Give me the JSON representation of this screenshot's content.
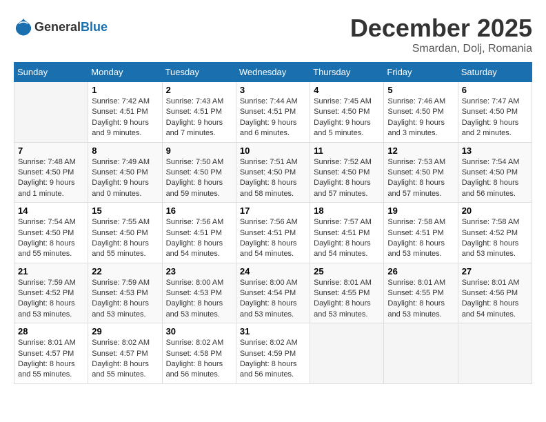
{
  "header": {
    "logo_general": "General",
    "logo_blue": "Blue",
    "month": "December 2025",
    "location": "Smardan, Dolj, Romania"
  },
  "weekdays": [
    "Sunday",
    "Monday",
    "Tuesday",
    "Wednesday",
    "Thursday",
    "Friday",
    "Saturday"
  ],
  "weeks": [
    [
      {
        "day": null
      },
      {
        "day": 1,
        "sunrise": "Sunrise: 7:42 AM",
        "sunset": "Sunset: 4:51 PM",
        "daylight": "Daylight: 9 hours and 9 minutes."
      },
      {
        "day": 2,
        "sunrise": "Sunrise: 7:43 AM",
        "sunset": "Sunset: 4:51 PM",
        "daylight": "Daylight: 9 hours and 7 minutes."
      },
      {
        "day": 3,
        "sunrise": "Sunrise: 7:44 AM",
        "sunset": "Sunset: 4:51 PM",
        "daylight": "Daylight: 9 hours and 6 minutes."
      },
      {
        "day": 4,
        "sunrise": "Sunrise: 7:45 AM",
        "sunset": "Sunset: 4:50 PM",
        "daylight": "Daylight: 9 hours and 5 minutes."
      },
      {
        "day": 5,
        "sunrise": "Sunrise: 7:46 AM",
        "sunset": "Sunset: 4:50 PM",
        "daylight": "Daylight: 9 hours and 3 minutes."
      },
      {
        "day": 6,
        "sunrise": "Sunrise: 7:47 AM",
        "sunset": "Sunset: 4:50 PM",
        "daylight": "Daylight: 9 hours and 2 minutes."
      }
    ],
    [
      {
        "day": 7,
        "sunrise": "Sunrise: 7:48 AM",
        "sunset": "Sunset: 4:50 PM",
        "daylight": "Daylight: 9 hours and 1 minute."
      },
      {
        "day": 8,
        "sunrise": "Sunrise: 7:49 AM",
        "sunset": "Sunset: 4:50 PM",
        "daylight": "Daylight: 9 hours and 0 minutes."
      },
      {
        "day": 9,
        "sunrise": "Sunrise: 7:50 AM",
        "sunset": "Sunset: 4:50 PM",
        "daylight": "Daylight: 8 hours and 59 minutes."
      },
      {
        "day": 10,
        "sunrise": "Sunrise: 7:51 AM",
        "sunset": "Sunset: 4:50 PM",
        "daylight": "Daylight: 8 hours and 58 minutes."
      },
      {
        "day": 11,
        "sunrise": "Sunrise: 7:52 AM",
        "sunset": "Sunset: 4:50 PM",
        "daylight": "Daylight: 8 hours and 57 minutes."
      },
      {
        "day": 12,
        "sunrise": "Sunrise: 7:53 AM",
        "sunset": "Sunset: 4:50 PM",
        "daylight": "Daylight: 8 hours and 57 minutes."
      },
      {
        "day": 13,
        "sunrise": "Sunrise: 7:54 AM",
        "sunset": "Sunset: 4:50 PM",
        "daylight": "Daylight: 8 hours and 56 minutes."
      }
    ],
    [
      {
        "day": 14,
        "sunrise": "Sunrise: 7:54 AM",
        "sunset": "Sunset: 4:50 PM",
        "daylight": "Daylight: 8 hours and 55 minutes."
      },
      {
        "day": 15,
        "sunrise": "Sunrise: 7:55 AM",
        "sunset": "Sunset: 4:50 PM",
        "daylight": "Daylight: 8 hours and 55 minutes."
      },
      {
        "day": 16,
        "sunrise": "Sunrise: 7:56 AM",
        "sunset": "Sunset: 4:51 PM",
        "daylight": "Daylight: 8 hours and 54 minutes."
      },
      {
        "day": 17,
        "sunrise": "Sunrise: 7:56 AM",
        "sunset": "Sunset: 4:51 PM",
        "daylight": "Daylight: 8 hours and 54 minutes."
      },
      {
        "day": 18,
        "sunrise": "Sunrise: 7:57 AM",
        "sunset": "Sunset: 4:51 PM",
        "daylight": "Daylight: 8 hours and 54 minutes."
      },
      {
        "day": 19,
        "sunrise": "Sunrise: 7:58 AM",
        "sunset": "Sunset: 4:51 PM",
        "daylight": "Daylight: 8 hours and 53 minutes."
      },
      {
        "day": 20,
        "sunrise": "Sunrise: 7:58 AM",
        "sunset": "Sunset: 4:52 PM",
        "daylight": "Daylight: 8 hours and 53 minutes."
      }
    ],
    [
      {
        "day": 21,
        "sunrise": "Sunrise: 7:59 AM",
        "sunset": "Sunset: 4:52 PM",
        "daylight": "Daylight: 8 hours and 53 minutes."
      },
      {
        "day": 22,
        "sunrise": "Sunrise: 7:59 AM",
        "sunset": "Sunset: 4:53 PM",
        "daylight": "Daylight: 8 hours and 53 minutes."
      },
      {
        "day": 23,
        "sunrise": "Sunrise: 8:00 AM",
        "sunset": "Sunset: 4:53 PM",
        "daylight": "Daylight: 8 hours and 53 minutes."
      },
      {
        "day": 24,
        "sunrise": "Sunrise: 8:00 AM",
        "sunset": "Sunset: 4:54 PM",
        "daylight": "Daylight: 8 hours and 53 minutes."
      },
      {
        "day": 25,
        "sunrise": "Sunrise: 8:01 AM",
        "sunset": "Sunset: 4:55 PM",
        "daylight": "Daylight: 8 hours and 53 minutes."
      },
      {
        "day": 26,
        "sunrise": "Sunrise: 8:01 AM",
        "sunset": "Sunset: 4:55 PM",
        "daylight": "Daylight: 8 hours and 53 minutes."
      },
      {
        "day": 27,
        "sunrise": "Sunrise: 8:01 AM",
        "sunset": "Sunset: 4:56 PM",
        "daylight": "Daylight: 8 hours and 54 minutes."
      }
    ],
    [
      {
        "day": 28,
        "sunrise": "Sunrise: 8:01 AM",
        "sunset": "Sunset: 4:57 PM",
        "daylight": "Daylight: 8 hours and 55 minutes."
      },
      {
        "day": 29,
        "sunrise": "Sunrise: 8:02 AM",
        "sunset": "Sunset: 4:57 PM",
        "daylight": "Daylight: 8 hours and 55 minutes."
      },
      {
        "day": 30,
        "sunrise": "Sunrise: 8:02 AM",
        "sunset": "Sunset: 4:58 PM",
        "daylight": "Daylight: 8 hours and 56 minutes."
      },
      {
        "day": 31,
        "sunrise": "Sunrise: 8:02 AM",
        "sunset": "Sunset: 4:59 PM",
        "daylight": "Daylight: 8 hours and 56 minutes."
      },
      {
        "day": null
      },
      {
        "day": null
      },
      {
        "day": null
      }
    ]
  ]
}
